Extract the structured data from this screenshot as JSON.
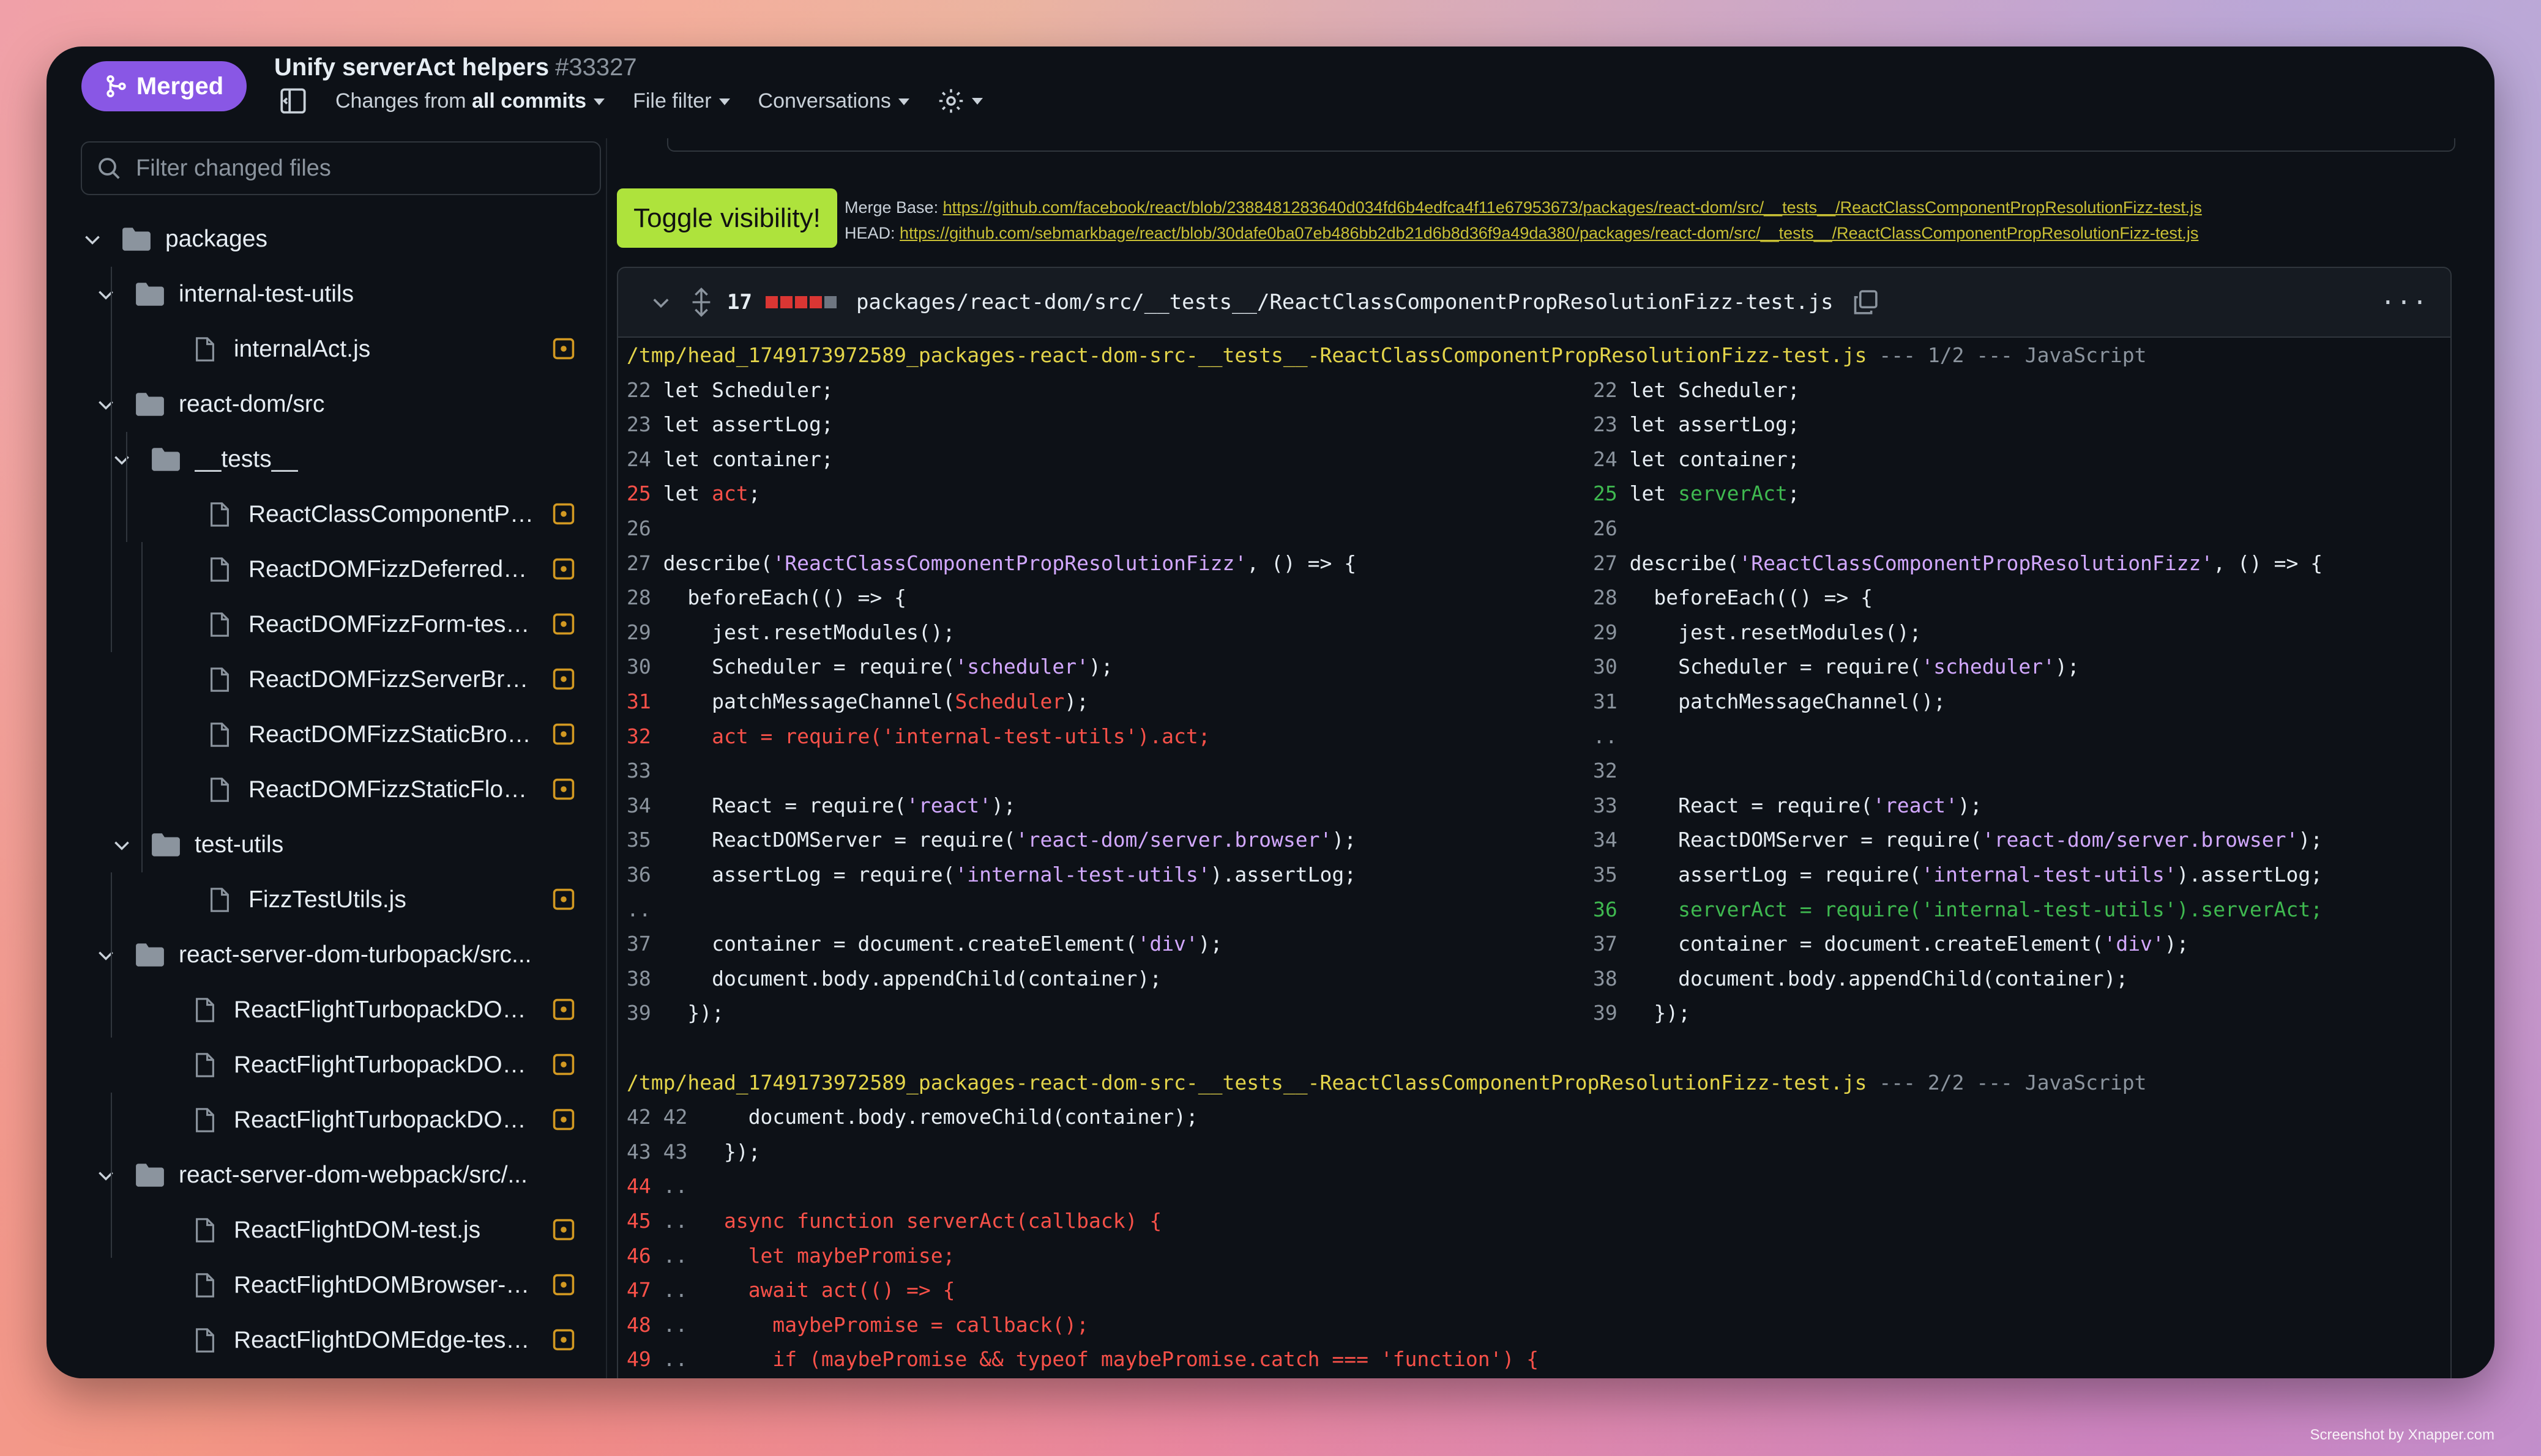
{
  "pr": {
    "status": "Merged",
    "title": "Unify serverAct helpers",
    "number": "#33327"
  },
  "toolbar": {
    "changes_prefix": "Changes from",
    "changes_value": "all commits",
    "file_filter": "File filter",
    "conversations": "Conversations"
  },
  "sidebar": {
    "filter_placeholder": "Filter changed files",
    "items": [
      {
        "type": "folder",
        "depth": 0,
        "label": "packages"
      },
      {
        "type": "folder",
        "depth": 1,
        "label": "internal-test-utils"
      },
      {
        "type": "file",
        "depth": 2,
        "label": "internalAct.js"
      },
      {
        "type": "folder",
        "depth": 1,
        "label": "react-dom/src"
      },
      {
        "type": "folder",
        "depth": 2,
        "label": "__tests__"
      },
      {
        "type": "file",
        "depth": 3,
        "label": "ReactClassComponentPro..."
      },
      {
        "type": "file",
        "depth": 3,
        "label": "ReactDOMFizzDeferredVal..."
      },
      {
        "type": "file",
        "depth": 3,
        "label": "ReactDOMFizzForm-test.js"
      },
      {
        "type": "file",
        "depth": 3,
        "label": "ReactDOMFizzServerBrow..."
      },
      {
        "type": "file",
        "depth": 3,
        "label": "ReactDOMFizzStaticBrows..."
      },
      {
        "type": "file",
        "depth": 3,
        "label": "ReactDOMFizzStaticFloat-..."
      },
      {
        "type": "folder",
        "depth": 2,
        "label": "test-utils"
      },
      {
        "type": "file",
        "depth": 3,
        "label": "FizzTestUtils.js"
      },
      {
        "type": "folder",
        "depth": 1,
        "label": "react-server-dom-turbopack/src..."
      },
      {
        "type": "file",
        "depth": 2,
        "label": "ReactFlightTurbopackDOM-..."
      },
      {
        "type": "file",
        "depth": 2,
        "label": "ReactFlightTurbopackDOM..."
      },
      {
        "type": "file",
        "depth": 2,
        "label": "ReactFlightTurbopackDOM..."
      },
      {
        "type": "folder",
        "depth": 1,
        "label": "react-server-dom-webpack/src/..."
      },
      {
        "type": "file",
        "depth": 2,
        "label": "ReactFlightDOM-test.js"
      },
      {
        "type": "file",
        "depth": 2,
        "label": "ReactFlightDOMBrowser-te..."
      },
      {
        "type": "file",
        "depth": 2,
        "label": "ReactFlightDOMEdge-test.js"
      }
    ]
  },
  "diff": {
    "toggle_label": "Toggle visibility!",
    "merge_base_label": "Merge Base:",
    "merge_base_url": "https://github.com/facebook/react/blob/2388481283640d034fd6b4edfca4f11e67953673/packages/react-dom/src/__tests__/ReactClassComponentPropResolutionFizz-test.js",
    "head_label": "HEAD:",
    "head_url": "https://github.com/sebmarkbage/react/blob/30dafe0ba07eb486bb2db21d6b8d36f9a49da380/packages/react-dom/src/__tests__/ReactClassComponentPropResolutionFizz-test.js",
    "changed_count": "17",
    "file_path": "packages/react-dom/src/__tests__/ReactClassComponentPropResolutionFizz-test.js",
    "more": "···",
    "hunk1_path": "/tmp/head_1749173972589_packages-react-dom-src-__tests__-ReactClassComponentPropResolutionFizz-test.js",
    "hunk1_info": " --- 1/2 --- JavaScript",
    "hunk2_path": "/tmp/head_1749173972589_packages-react-dom-src-__tests__-ReactClassComponentPropResolutionFizz-test.js",
    "hunk2_info": " --- 2/2 --- JavaScript"
  },
  "colors": {
    "merged": "#8957e5",
    "toggle": "#aee33c",
    "removed": "#f85149",
    "added": "#3fb950",
    "string": "#d2a8ff",
    "path": "#e3d44a"
  },
  "watermark": "Screenshot by Xnapper.com"
}
